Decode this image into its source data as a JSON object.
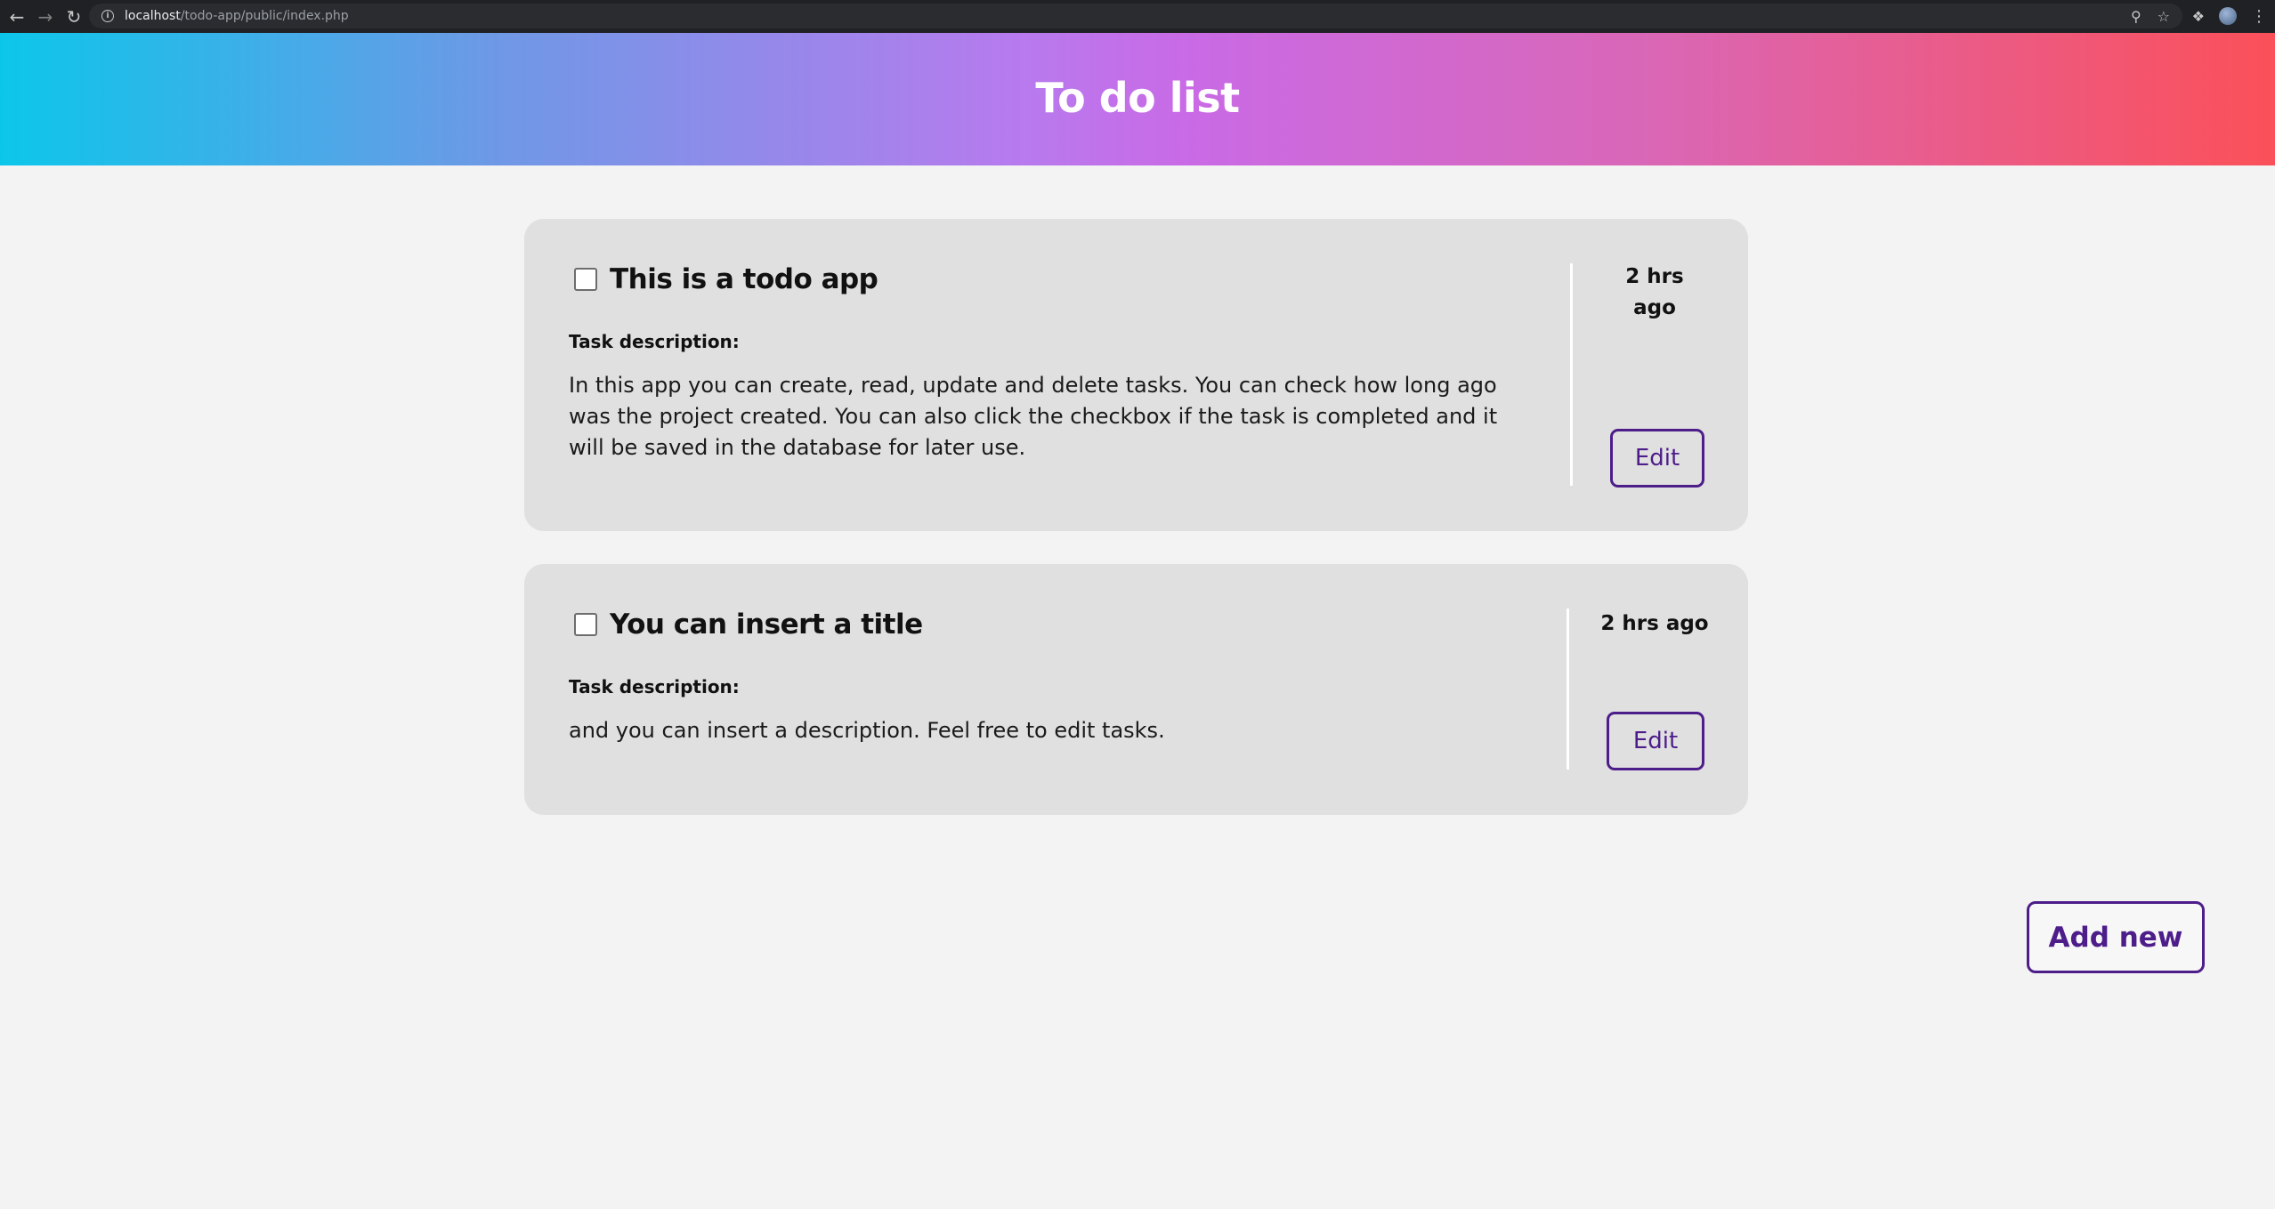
{
  "browser": {
    "url_host": "localhost",
    "url_path": "/todo-app/public/index.php"
  },
  "header": {
    "title": "To do list"
  },
  "tasks": [
    {
      "title": "This is a todo app",
      "completed": false,
      "description_label": "Task description:",
      "description": "In this app you can create, read, update and delete tasks. You can check how long ago was the project created. You can also click the checkbox if the task is completed and it will be saved in the database for later use.",
      "time_ago": "2 hrs ago",
      "edit_label": "Edit"
    },
    {
      "title": "You can insert a title",
      "completed": false,
      "description_label": "Task description:",
      "description": "and you can insert a description. Feel free to edit tasks.",
      "time_ago": "2 hrs ago",
      "edit_label": "Edit"
    }
  ],
  "actions": {
    "add_new_label": "Add new"
  },
  "colors": {
    "accent": "#4d1d8a",
    "card_bg": "#e0e0e0",
    "page_bg": "#f3f3f3",
    "header_gradient": [
      "#0cc6ea",
      "#c96ae6",
      "#fb5059"
    ]
  }
}
